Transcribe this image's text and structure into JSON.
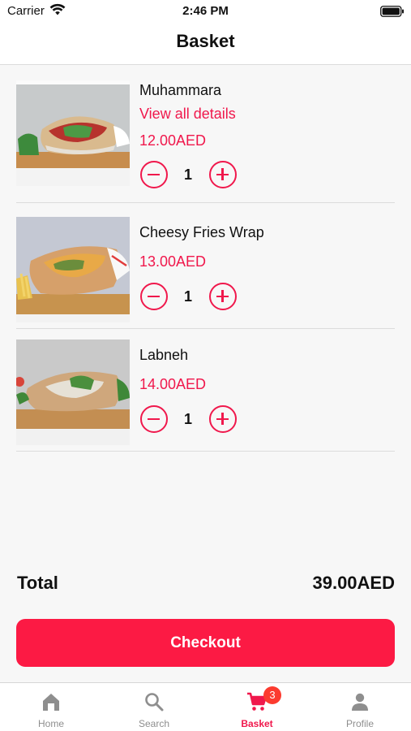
{
  "status_bar": {
    "carrier": "Carrier",
    "time": "2:46 PM"
  },
  "header": {
    "title": "Basket"
  },
  "items": [
    {
      "name": "Muhammara",
      "link": "View all details",
      "price": "12.00AED",
      "qty": "1"
    },
    {
      "name": "Cheesy Fries Wrap",
      "price": "13.00AED",
      "qty": "1"
    },
    {
      "name": "Labneh",
      "price": "14.00AED",
      "qty": "1"
    }
  ],
  "summary": {
    "total_label": "Total",
    "total_value": "39.00AED"
  },
  "checkout": {
    "label": "Checkout"
  },
  "tabs": [
    {
      "label": "Home",
      "icon": "home-icon"
    },
    {
      "label": "Search",
      "icon": "search-icon"
    },
    {
      "label": "Basket",
      "icon": "cart-icon",
      "badge": "3"
    },
    {
      "label": "Profile",
      "icon": "person-icon"
    }
  ],
  "colors": {
    "accent": "#f0184c",
    "button": "#fc1a44",
    "badge": "#fc3b2f",
    "inactive": "#8e8e8e"
  }
}
